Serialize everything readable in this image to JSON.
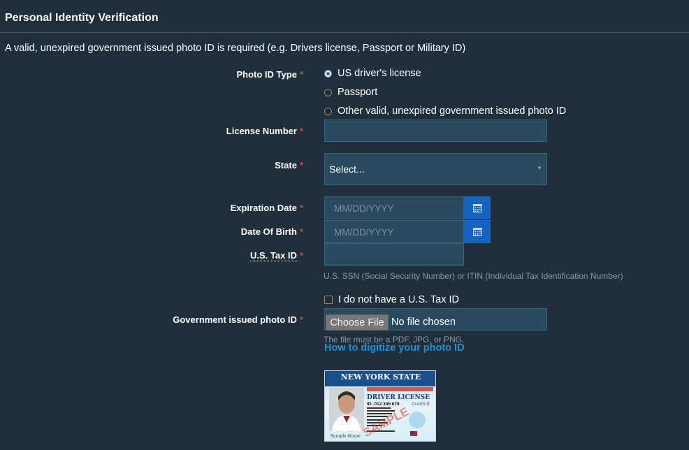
{
  "section": {
    "title": "Personal Identity Verification",
    "intro": "A valid, unexpired government issued photo ID is required (e.g. Drivers license, Passport or Military ID)"
  },
  "required_mark": "*",
  "photo_id_type": {
    "label": "Photo ID Type",
    "options": [
      {
        "label": "US driver's license",
        "selected": true
      },
      {
        "label": "Passport",
        "selected": false
      },
      {
        "label": "Other valid, unexpired government issued photo ID",
        "selected": false
      }
    ]
  },
  "license_number": {
    "label": "License Number",
    "value": ""
  },
  "state": {
    "label": "State",
    "selected": "Select..."
  },
  "expiration_date": {
    "label": "Expiration Date",
    "placeholder": "MM/DD/YYYY",
    "icon": "calendar-icon"
  },
  "date_of_birth": {
    "label": "Date Of Birth",
    "placeholder": "MM/DD/YYYY",
    "icon": "calendar-icon"
  },
  "tax_id": {
    "label": "U.S. Tax ID",
    "value": "",
    "help": "U.S. SSN (Social Security Number) or ITIN (Individual Tax Identification Number)",
    "no_tax_id_label": "I do not have a U.S. Tax ID",
    "no_tax_id_checked": false
  },
  "photo_upload": {
    "label": "Government issued photo ID",
    "button": "Choose File",
    "status": "No file chosen",
    "help": "The file must be a PDF, JPG, or PNG.",
    "link": "How to digitize your photo ID"
  },
  "sample_card": {
    "state": "NEW YORK STATE",
    "title": "DRIVER LICENSE",
    "class": "CLASS D",
    "id_line": "ID: 012 345 678",
    "watermark": "SAMPLE"
  },
  "colors": {
    "background": "#1f2f3c",
    "input_bg": "#2a4a60",
    "required": "#e0463e",
    "calendar_button": "#1565c0",
    "link": "#1e90d4"
  }
}
